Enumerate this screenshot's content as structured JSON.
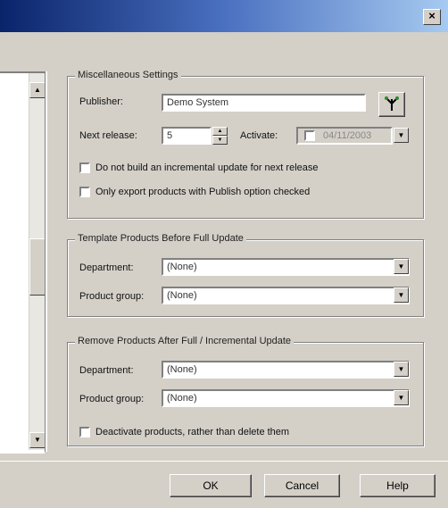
{
  "window": {
    "close_glyph": "×"
  },
  "misc": {
    "legend": "Miscellaneous Settings",
    "publisher_label": "Publisher:",
    "publisher_value": "Demo System",
    "next_release_label": "Next release:",
    "next_release_value": "5",
    "activate_label": "Activate:",
    "activate_date": "04/11/2003",
    "check1_label": "Do not build an incremental update for next release",
    "check2_label": "Only export products with Publish option checked"
  },
  "template": {
    "legend": "Template Products Before Full Update",
    "department_label": "Department:",
    "department_value": "(None)",
    "product_group_label": "Product group:",
    "product_group_value": "(None)"
  },
  "remove": {
    "legend": "Remove Products After Full / Incremental Update",
    "department_label": "Department:",
    "department_value": "(None)",
    "product_group_label": "Product group:",
    "product_group_value": "(None)",
    "check_label": "Deactivate products, rather than delete them"
  },
  "buttons": {
    "ok": "OK",
    "cancel": "Cancel",
    "help": "Help"
  },
  "icons": {
    "publisher_pick": "tree-icon",
    "accent": "#0a246a"
  }
}
